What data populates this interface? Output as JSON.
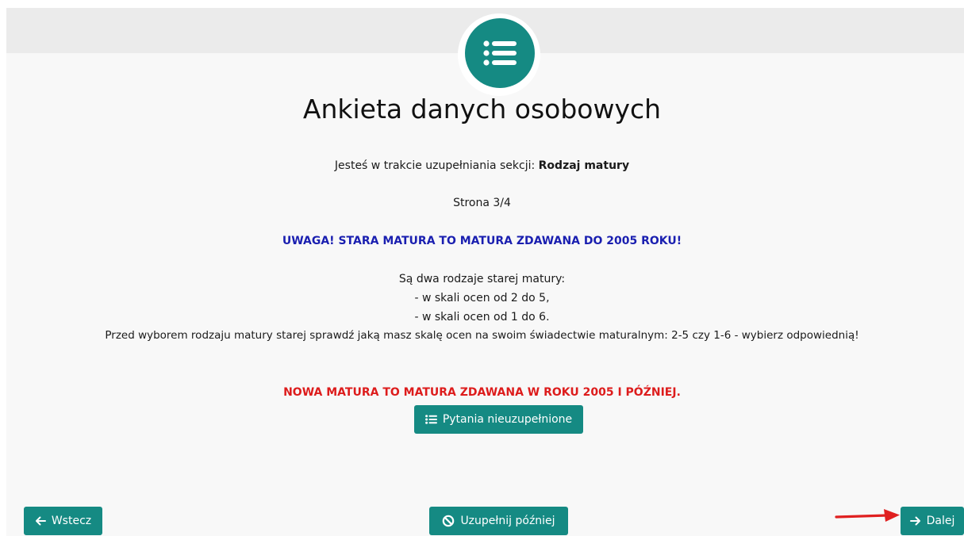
{
  "header": {
    "icon": "list-icon",
    "title": "Ankieta danych osobowych"
  },
  "section_info": {
    "prefix": "Jesteś w trakcie uzupełniania sekcji:",
    "section_name": "Rodzaj matury"
  },
  "page_indicator": "Strona 3/4",
  "warning_old": "UWAGA! STARA MATURA TO MATURA ZDAWANA DO 2005 ROKU!",
  "info_lines": [
    "Są dwa rodzaje starej matury:",
    "- w skali ocen od 2 do 5,",
    "- w skali ocen od 1 do 6.",
    "Przed wyborem rodzaju matury starej sprawdź jaką masz skalę ocen na swoim świadectwie maturalnym: 2-5 czy 1-6 - wybierz odpowiednią!"
  ],
  "warning_new": "NOWA MATURA TO MATURA ZDAWANA W ROKU 2005 I PÓŹNIEJ.",
  "buttons": {
    "unanswered": "Pytania nieuzupełnione",
    "back": "Wstecz",
    "later": "Uzupełnij później",
    "next": "Dalej"
  },
  "colors": {
    "accent": "#158a83",
    "warning_blue": "#1a1fb0",
    "warning_red": "#dd1c1c",
    "annotation_arrow": "#e02020"
  }
}
